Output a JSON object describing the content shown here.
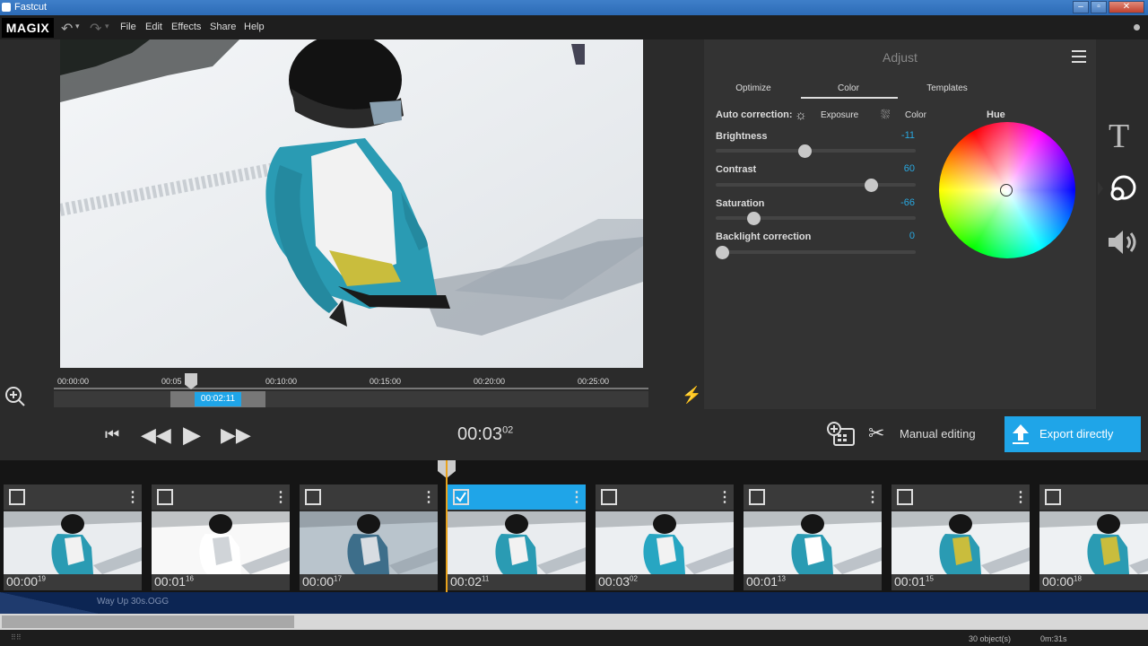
{
  "window": {
    "title": "Fastcut"
  },
  "menu": {
    "logo": "MAGIX",
    "items": [
      "File",
      "Edit",
      "Effects",
      "Share",
      "Help"
    ]
  },
  "adjust": {
    "title": "Adjust",
    "tabs": [
      "Optimize",
      "Color",
      "Templates"
    ],
    "active_tab": "Color",
    "auto_correction": "Auto correction:",
    "exposure": "Exposure",
    "color": "Color",
    "hue": "Hue",
    "sliders": [
      {
        "label": "Brightness",
        "value": "-11",
        "level": 0.44
      },
      {
        "label": "Contrast",
        "value": "60",
        "level": 0.8
      },
      {
        "label": "Saturation",
        "value": "-66",
        "level": 0.17
      },
      {
        "label": "Backlight correction",
        "value": "0",
        "level": 0.0
      }
    ]
  },
  "ruler": {
    "ticks": [
      "00:00:00",
      "00:05",
      "00:10:00",
      "00:15:00",
      "00:20:00",
      "00:25:00"
    ],
    "position": "00:02:11"
  },
  "transport": {
    "timecode_main": "00:03",
    "timecode_frames": "02",
    "manual_editing": "Manual editing",
    "export": "Export directly"
  },
  "clips": [
    {
      "dur": "00:00",
      "frames": "19",
      "selected": false
    },
    {
      "dur": "00:01",
      "frames": "16",
      "selected": false
    },
    {
      "dur": "00:00",
      "frames": "17",
      "selected": false
    },
    {
      "dur": "00:02",
      "frames": "11",
      "selected": true
    },
    {
      "dur": "00:03",
      "frames": "02",
      "selected": false
    },
    {
      "dur": "00:01",
      "frames": "13",
      "selected": false
    },
    {
      "dur": "00:01",
      "frames": "15",
      "selected": false
    },
    {
      "dur": "00:00",
      "frames": "18",
      "selected": false
    }
  ],
  "audio": {
    "track": "Way Up 30s.OGG"
  },
  "status": {
    "objects": "30 object(s)",
    "duration": "0m:31s"
  },
  "colors": {
    "accent": "#1fa5e8",
    "playhead": "#e8a21c",
    "audio_bg": "#0c2553"
  }
}
